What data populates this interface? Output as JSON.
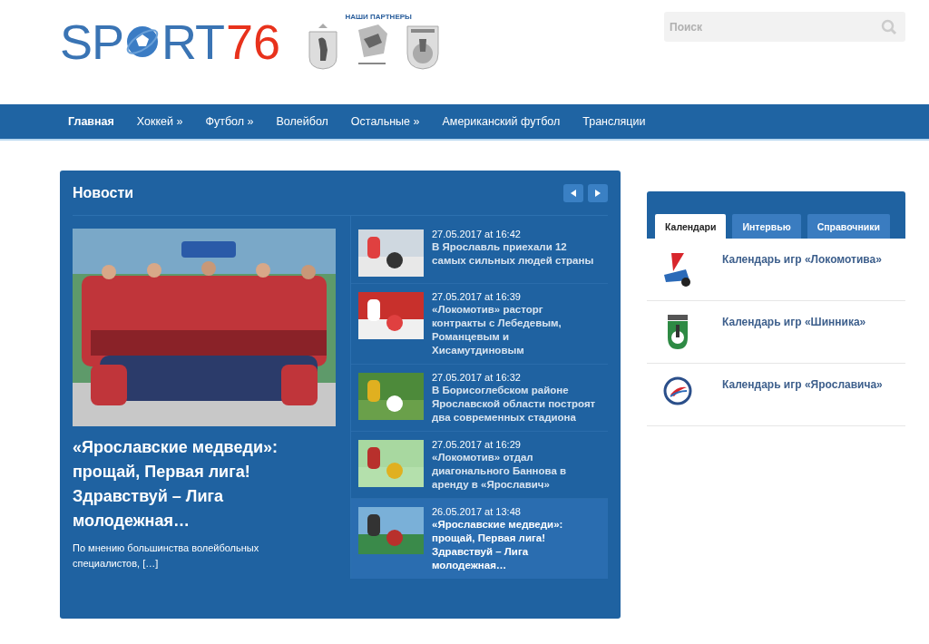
{
  "logo": {
    "left": "SP",
    "right": "RT",
    "number": "76"
  },
  "partners": {
    "label": "НАШИ ПАРТНЕРЫ"
  },
  "search": {
    "placeholder": "Поиск"
  },
  "nav": [
    {
      "label": "Главная",
      "selected": true
    },
    {
      "label": "Хоккей »",
      "selected": false
    },
    {
      "label": "Футбол »",
      "selected": false
    },
    {
      "label": "Волейбол",
      "selected": false
    },
    {
      "label": "Остальные »",
      "selected": false
    },
    {
      "label": "Американский футбол",
      "selected": false
    },
    {
      "label": "Трансляции",
      "selected": false
    }
  ],
  "news": {
    "title": "Новости",
    "featured": {
      "title": "«Ярославские медведи»: прощай, Первая лига! Здравствуй – Лига молодежная…",
      "excerpt": "По мнению большинства волейбольных специалистов, […]"
    },
    "items": [
      {
        "date": "27.05.2017 at 16:42",
        "title": "В Ярославль приехали 12 самых сильных людей страны",
        "selected": false
      },
      {
        "date": "27.05.2017 at 16:39",
        "title": "«Локомотив» расторг контракты с Лебедевым, Романцевым и Хисамутдиновым",
        "selected": false
      },
      {
        "date": "27.05.2017 at 16:32",
        "title": "В Борисоглебском районе Ярославской области построят два современных стадиона",
        "selected": false
      },
      {
        "date": "27.05.2017 at 16:29",
        "title": "«Локомотив» отдал диагонального Баннова в аренду в «Ярославич»",
        "selected": false
      },
      {
        "date": "26.05.2017 at 13:48",
        "title": "«Ярославские медведи»: прощай, Первая лига! Здравствуй – Лига молодежная…",
        "selected": true
      }
    ]
  },
  "sidebar": {
    "tabs": [
      {
        "label": "Календари",
        "selected": true
      },
      {
        "label": "Интервью",
        "selected": false
      },
      {
        "label": "Справочники",
        "selected": false
      }
    ],
    "items": [
      {
        "title": "Календарь игр «Локомотива»"
      },
      {
        "title": "Календарь игр «Шинника»"
      },
      {
        "title": "Календарь игр «Ярославича»"
      }
    ]
  }
}
